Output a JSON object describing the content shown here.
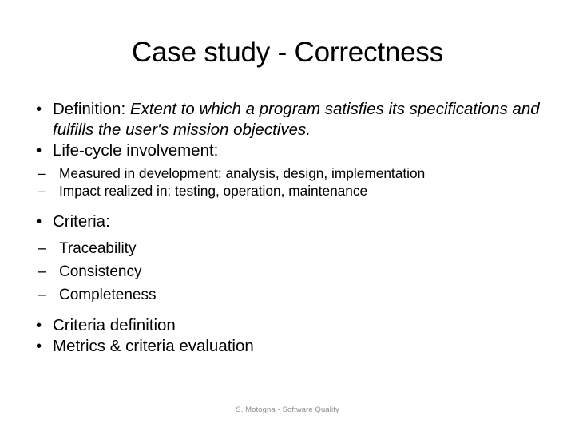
{
  "slide": {
    "title": "Case study - Correctness",
    "background_color": "#ffffff",
    "text_color": "#000000",
    "bullet_glyph": "•",
    "sub_bullet_glyph": "–",
    "blocks": {
      "definition": {
        "label": "Definition:",
        "definition_text": "Extent to which a program satisfies its specifications and fulfills the user's mission objectives."
      },
      "lifecycle": {
        "heading": "Life-cycle involvement:",
        "items": [
          "Measured in development: analysis, design, implementation",
          "Impact realized in: testing, operation, maintenance"
        ]
      },
      "criteria": {
        "heading": "Criteria:",
        "items": [
          "Traceability",
          "Consistency",
          "Completeness"
        ]
      },
      "criteria_definition": "Criteria definition",
      "metrics_evaluation": "Metrics & criteria evaluation"
    },
    "footer": {
      "text": "S. Motogna - Software Quality",
      "color": "#8d8d8d"
    }
  }
}
